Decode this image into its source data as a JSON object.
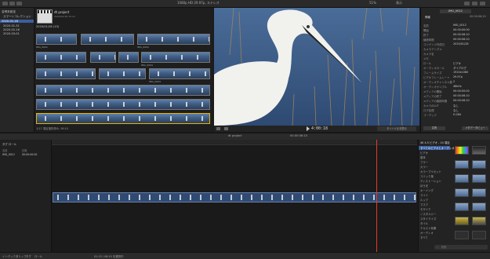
{
  "toolbar": {
    "center_label": "1080p HD 29.97p, ステレオ",
    "zoom": "51%",
    "viewer_label": "表示",
    "inspector_title": "IMG_0012",
    "inspector_time": "00:00:06;10"
  },
  "sidebar": {
    "items": [
      {
        "label": "名称未設定"
      },
      {
        "label": "スマートコレクション"
      },
      {
        "label": "2020-01-18"
      },
      {
        "label": "2020-01-31"
      },
      {
        "label": "2020-02-16"
      },
      {
        "label": "2020-03-01"
      }
    ]
  },
  "browser": {
    "project_name": "dt project",
    "project_meta": "2020/01/18 15:21",
    "event_header": "2020/01/28  (13)",
    "clip_names": [
      "IMG_0001",
      "IMG_0002",
      "IMG_0003",
      "IMG_0004",
      "IMG_0005",
      "IMG_0006",
      "IMG_0007",
      "IMG_0008",
      "IMG_0009",
      "IMG_0010",
      "IMG_0011",
      "IMG_0012"
    ],
    "status": "1/17 項目選択済み, 06:10"
  },
  "viewer": {
    "timecode": "4:00:18",
    "icons": [
      "expand-icon",
      "play-icon",
      "fullscreen-icon"
    ],
    "right_label": "タイトルを非表示"
  },
  "inspector": {
    "tabs": [
      "情報",
      "ビデオ"
    ],
    "rows": [
      {
        "k": "名前",
        "v": "IMG_0012"
      },
      {
        "k": "開始",
        "v": "00:00:00:00"
      },
      {
        "k": "終了",
        "v": "00:00:06:10"
      },
      {
        "k": "継続時間",
        "v": "00:00:06:10"
      },
      {
        "k": "コンテンツ作成日",
        "v": "2020/01/28"
      },
      {
        "k": "カメラアングル",
        "v": ""
      },
      {
        "k": "カメラ名",
        "v": ""
      },
      {
        "k": "メモ",
        "v": ""
      },
      {
        "k": "ロール",
        "v": "ビデオ"
      },
      {
        "k": "オーディオロール",
        "v": "ダイアログ"
      },
      {
        "k": "フレームサイズ",
        "v": "1920x1080"
      },
      {
        "k": "ビデオフレームレート",
        "v": "29.97p"
      },
      {
        "k": "オーディオチャンネル数",
        "v": "2"
      },
      {
        "k": "オーディオサンプル",
        "v": "48kHz"
      },
      {
        "k": "メディアの開始",
        "v": "00:00:00:00"
      },
      {
        "k": "メディアの終了",
        "v": "00:00:06:10"
      },
      {
        "k": "メディアの継続時間",
        "v": "00:00:06:10"
      },
      {
        "k": "カメラのLUT",
        "v": "なし"
      },
      {
        "k": "ログ処理",
        "v": "なし"
      },
      {
        "k": "コーデック",
        "v": "H.264"
      }
    ],
    "footer_left": "共有",
    "footer_right": "メタデータビュー"
  },
  "timeline": {
    "index_header": "タグ  ロール",
    "index_cols": [
      "名前",
      "位置"
    ],
    "index_row": [
      "IMG_0012",
      "00:00:00:00"
    ],
    "project_label": "dt project",
    "duration": "00:00:06:10"
  },
  "effects": {
    "header": "4K 4.5  ビデオ - 10 項目",
    "categories": [
      "すべてのビデオとオーディオ",
      "ビデオ",
      "基本",
      "ブラー",
      "カラー",
      "カラープリセット",
      "コミック風",
      "ディストーション",
      "ほう光",
      "キーイング",
      "ライト",
      "ルック",
      "マスク",
      "モザイク",
      "ノスタルジー",
      "スタイライズ",
      "タイル",
      "テキスト効果",
      "オーディオ",
      "すべて"
    ],
    "search_placeholder": "検索"
  },
  "bottom": {
    "tabs": [
      "インデックス",
      "クリップ",
      "タグ",
      "ロール"
    ],
    "status": "01:15 / 06:10 を選択中"
  }
}
